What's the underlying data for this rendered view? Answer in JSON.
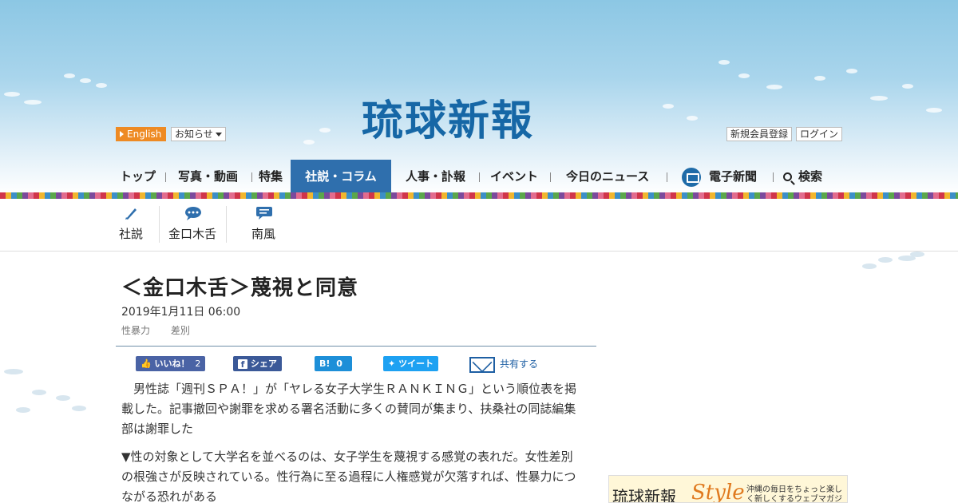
{
  "header": {
    "logo": "琉球新報",
    "english_label": "English",
    "notice_label": "お知らせ",
    "register_label": "新規会員登録",
    "login_label": "ログイン"
  },
  "nav": {
    "items": [
      {
        "label": "トップ"
      },
      {
        "label": "写真・動画"
      },
      {
        "label": "特集"
      },
      {
        "label": "社説・コラム"
      },
      {
        "label": "人事・訃報"
      },
      {
        "label": "イベント"
      },
      {
        "label": "今日のニュース"
      },
      {
        "label": "電子新聞"
      },
      {
        "label": "検索"
      }
    ],
    "active_index": 3,
    "accent_color": "#2f6fad"
  },
  "subnav": {
    "items": [
      {
        "label": "社説",
        "icon": "pen-icon"
      },
      {
        "label": "金口木舌",
        "icon": "speech-bubble-icon"
      },
      {
        "label": "南風",
        "icon": "message-icon"
      }
    ]
  },
  "article": {
    "title": "＜金口木舌＞蔑視と同意",
    "date": "2019年1月11日 06:00",
    "tags": [
      "性暴力",
      "差別"
    ],
    "paragraphs": [
      "　男性誌「週刊ＳＰＡ！」が「ヤレる女子大学生ＲＡＮＫＩＮＧ」という順位表を掲載した。記事撤回や謝罪を求める署名活動に多くの賛同が集まり、扶桑社の同誌編集部は謝罪した",
      "▼性の対象として大学名を並べるのは、女子学生を蔑視する感覚の表れだ。女性差別の根強さが反映されている。性行為に至る過程に人権感覚が欠落すれば、性暴力につながる恐れがある"
    ]
  },
  "share": {
    "like_label": "いいね！",
    "like_count": "2",
    "fb_share_label": "シェア",
    "hatena_label": "B!",
    "hatena_count": "0",
    "tweet_label": "ツイート",
    "share_all_label": "共有する"
  },
  "ad": {
    "brand": "琉球新報",
    "brand_style": "Style",
    "tagline": "沖縄の毎日をちょっと楽しく新しくするウェブマガジン"
  }
}
